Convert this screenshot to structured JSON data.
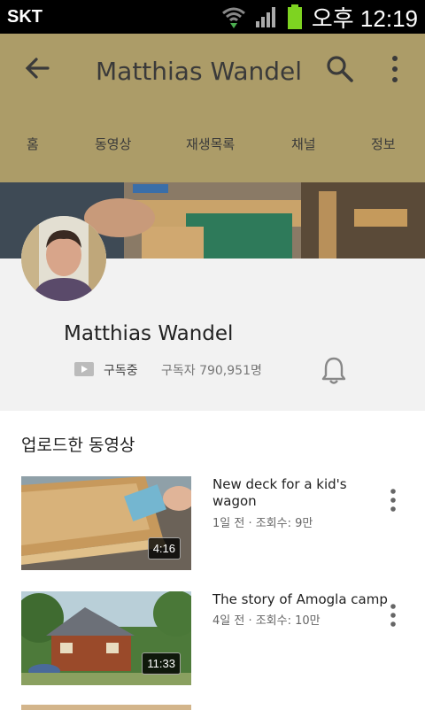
{
  "status_bar": {
    "carrier": "SKT",
    "time": "오후 12:19",
    "icons": [
      "wifi-icon",
      "signal-icon",
      "battery-icon"
    ]
  },
  "app_bar": {
    "title": "Matthias Wandel",
    "color": "#ac9c68",
    "tabs": [
      "홈",
      "동영상",
      "재생목록",
      "채널",
      "정보"
    ]
  },
  "channel": {
    "name": "Matthias Wandel",
    "subscribed_label": "구독중",
    "subscriber_count": "구독자 790,951명"
  },
  "uploads": {
    "section_title": "업로드한 동영상",
    "videos": [
      {
        "title": "New deck for a kid's wagon",
        "meta": "1일 전 · 조회수: 9만",
        "duration": "4:16"
      },
      {
        "title": "The story of Amogla camp",
        "meta": "4일 전 · 조회수: 10만",
        "duration": "11:33"
      }
    ]
  }
}
